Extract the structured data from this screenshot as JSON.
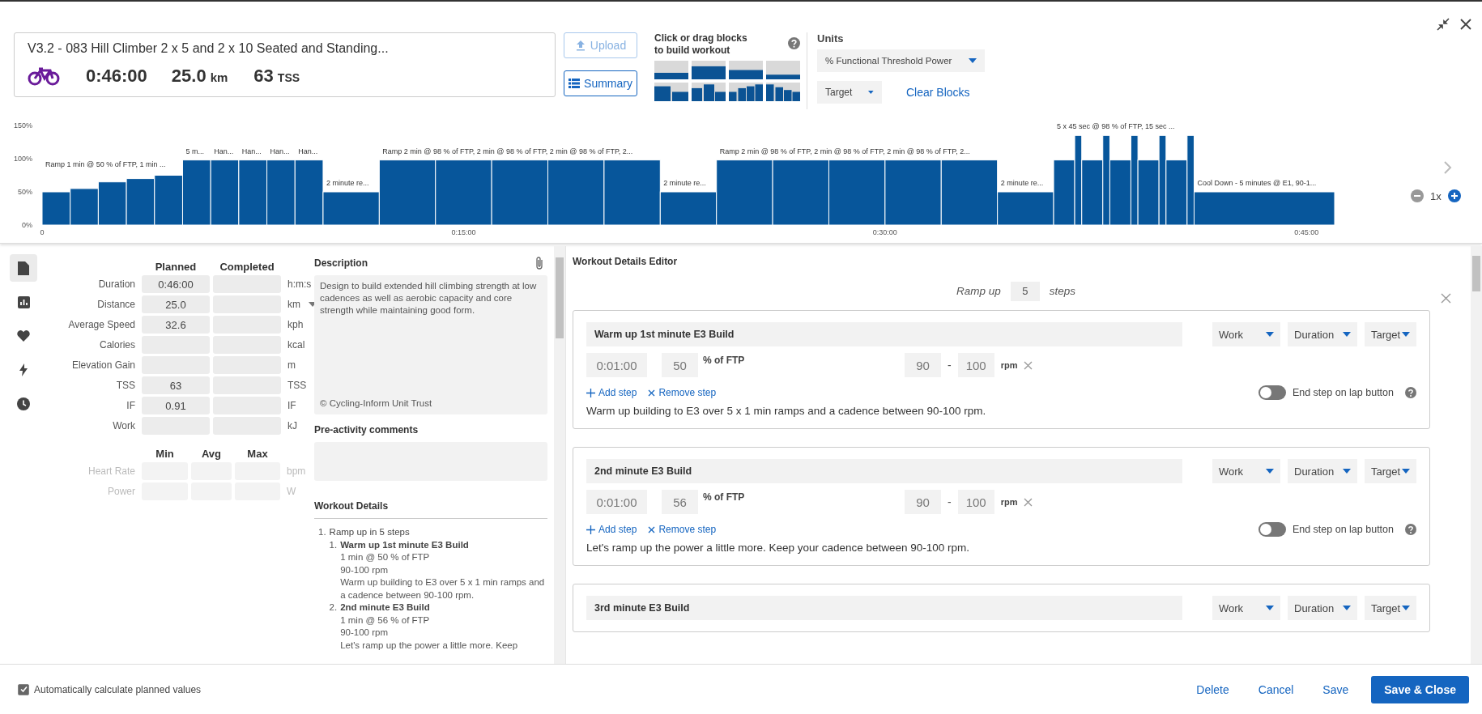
{
  "header": {
    "title": "V3.2 - 083 Hill Climber 2 x 5 and 2 x 10 Seated and Standing...",
    "duration": "0:46:00",
    "distance": "25.0",
    "distance_unit": "km",
    "tss": "63",
    "tss_unit": "TSS",
    "upload": "Upload",
    "upload_disabled": true,
    "summary": "Summary"
  },
  "builder": {
    "hint": "Click or drag blocks to build workout",
    "units_label": "Units",
    "units_value": "% Functional Threshold Power",
    "target_value": "Target",
    "clear": "Clear Blocks"
  },
  "profile": {
    "zoom": "1x",
    "chart_data": {
      "type": "bar",
      "xlim": [
        0,
        46
      ],
      "ylim": [
        0,
        150
      ],
      "yticks": [
        {
          "value": 0,
          "label": "0%"
        },
        {
          "value": 50,
          "label": "50%"
        },
        {
          "value": 100,
          "label": "100%"
        },
        {
          "value": 150,
          "label": "150%"
        }
      ],
      "xticks": [
        {
          "value": 0,
          "label": "0"
        },
        {
          "value": 15,
          "label": "0:15:00"
        },
        {
          "value": 30,
          "label": "0:30:00"
        },
        {
          "value": 45,
          "label": "0:45:00"
        }
      ],
      "x": [
        0.5,
        1.5,
        2.5,
        3.5,
        4.5,
        5.5,
        6.5,
        7.5,
        8.5,
        9.5,
        11,
        13,
        15,
        17,
        19,
        21,
        23,
        25,
        27,
        29,
        31,
        33,
        35,
        36.375,
        36.875,
        37.375,
        37.875,
        38.375,
        38.875,
        39.375,
        39.875,
        40.375,
        40.875,
        43.5
      ],
      "values": [
        50,
        55,
        65,
        70,
        75,
        98,
        98,
        98,
        98,
        98,
        50,
        98,
        98,
        98,
        98,
        98,
        50,
        98,
        98,
        98,
        98,
        98,
        50,
        98,
        135,
        98,
        135,
        98,
        135,
        98,
        135,
        98,
        135,
        50
      ],
      "annotations": [
        "Ramp 1 min @ 50 % of FTP, 1 min ...",
        "5 m...",
        "Han...",
        "Han...",
        "Han...",
        "Han...",
        "2 minute re...",
        "Ramp 2 min @ 98 % of FTP, 2 min @ 98 % of FTP, 2 min @ 98 % of FTP, 2...",
        "2 minute re...",
        "Ramp 2 min @ 98 % of FTP, 2 min @ 98 % of FTP, 2 min @ 98 % of FTP, 2...",
        "2 minute re...",
        "5 x 45 sec @ 98 % of FTP, 15 sec ...",
        "Cool Down - 5 minutes @ E1, 90-1..."
      ]
    }
  },
  "sidebar": {
    "items": [
      {
        "selected": true
      },
      {
        "selected": false
      },
      {
        "selected": false
      },
      {
        "selected": false
      },
      {
        "selected": false
      }
    ]
  },
  "stats": {
    "columns": [
      "Planned",
      "Completed"
    ],
    "rows": [
      {
        "label": "Duration",
        "planned": "0:46:00",
        "unit": "h:m:s",
        "unit_dropdown": false
      },
      {
        "label": "Distance",
        "planned": "25.0",
        "unit": "km",
        "unit_dropdown": true
      },
      {
        "label": "Average Speed",
        "planned": "32.6",
        "unit": "kph",
        "unit_dropdown": false
      },
      {
        "label": "Calories",
        "unit": "kcal",
        "unit_dropdown": false
      },
      {
        "label": "Elevation Gain",
        "unit": "m",
        "unit_dropdown": false
      },
      {
        "label": "TSS",
        "planned": "63",
        "unit": "TSS",
        "unit_dropdown": false
      },
      {
        "label": "IF",
        "planned": "0.91",
        "unit": "IF",
        "unit_dropdown": false
      },
      {
        "label": "Work",
        "unit": "kJ",
        "unit_dropdown": false
      }
    ],
    "range_columns": [
      "Min",
      "Avg",
      "Max"
    ],
    "range_rows": [
      {
        "label": "Heart Rate",
        "unit": "bpm",
        "disabled": true
      },
      {
        "label": "Power",
        "unit": "W",
        "disabled": true
      }
    ]
  },
  "description": {
    "title": "Description",
    "text": "Design to build extended hill climbing strength at low cadences as well as aerobic capacity and core strength while maintaining good form.",
    "copyright": "© Cycling-Inform Unit Trust"
  },
  "comments": {
    "title": "Pre-activity comments"
  },
  "details": {
    "title": "Workout Details",
    "items": [
      {
        "number": "1.",
        "title": "Ramp up in 5 steps",
        "children": [
          {
            "number": "1.",
            "title": "Warm up 1st minute E3 Build",
            "lines": [
              "1 min @ 50 % of FTP",
              "90-100 rpm",
              "Warm up building to E3 over 5 x 1 min ramps and a cadence between 90-100 rpm."
            ]
          },
          {
            "number": "2.",
            "title": "2nd minute E3 Build",
            "lines": [
              "1 min @ 56 % of FTP",
              "90-100 rpm",
              "Let's ramp up the power a little more. Keep"
            ]
          }
        ]
      }
    ]
  },
  "editor": {
    "title": "Workout Details Editor",
    "repeat_prefix": "Ramp up",
    "repeat_count": "5",
    "repeat_suffix": "steps",
    "steps": [
      {
        "name": "Warm up 1st minute E3 Build",
        "intensity": "Work",
        "duration_type": "Duration",
        "target_type": "Target",
        "duration": "0:01:00",
        "target": "50",
        "target_unit": "% of FTP",
        "cadence_low": "90",
        "cadence_separator": "-",
        "cadence_high": "100",
        "cadence_unit": "rpm",
        "add": "Add step",
        "remove": "Remove step",
        "lap_label": "End step on lap button",
        "lap_on": false,
        "notes": "Warm up building to E3 over 5 x 1 min ramps and a cadence between 90-100 rpm."
      },
      {
        "name": "2nd minute E3 Build",
        "intensity": "Work",
        "duration_type": "Duration",
        "target_type": "Target",
        "duration": "0:01:00",
        "target": "56",
        "target_unit": "% of FTP",
        "cadence_low": "90",
        "cadence_separator": "-",
        "cadence_high": "100",
        "cadence_unit": "rpm",
        "add": "Add step",
        "remove": "Remove step",
        "lap_label": "End step on lap button",
        "lap_on": false,
        "notes": "Let's ramp up the power a little more. Keep your cadence between 90-100 rpm."
      },
      {
        "name": "3rd minute E3 Build",
        "intensity": "Work",
        "duration_type": "Duration",
        "target_type": "Target"
      }
    ]
  },
  "footer": {
    "auto_label": "Automatically calculate planned values",
    "auto_checked": true,
    "buttons": [
      {
        "label": "Delete",
        "kind": "link"
      },
      {
        "label": "Cancel",
        "kind": "link"
      },
      {
        "label": "Save",
        "kind": "link"
      },
      {
        "label": "Save & Close",
        "kind": "primary"
      }
    ]
  }
}
